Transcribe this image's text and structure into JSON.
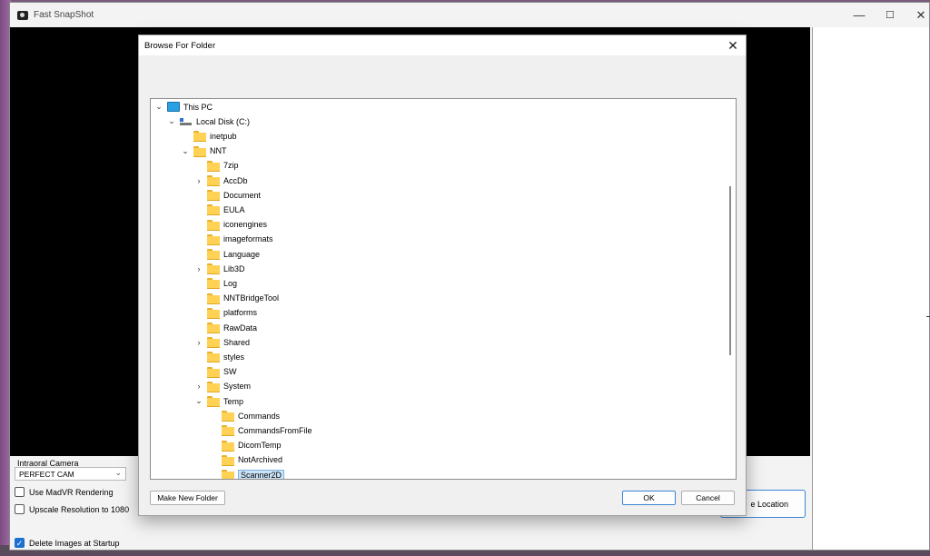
{
  "window": {
    "title": "Fast SnapShot",
    "minimize": "—",
    "maximize": "☐",
    "close": "✕"
  },
  "controls": {
    "camera_group_label": "Intraoral Camera",
    "camera_select": "PERFECT CAM",
    "use_madvr": {
      "label": "Use MadVR Rendering",
      "checked": false
    },
    "upscale": {
      "label": "Upscale Resolution to 1080",
      "checked": false
    },
    "delete_images": {
      "label": "Delete Images at Startup",
      "checked": true
    },
    "save_location_button": "e Location"
  },
  "dialog": {
    "title": "Browse For Folder",
    "close": "✕",
    "tree": [
      {
        "label": "This PC",
        "level": 0,
        "icon": "pc",
        "expander": "expanded"
      },
      {
        "label": "Local Disk (C:)",
        "level": 1,
        "icon": "drive",
        "expander": "expanded"
      },
      {
        "label": "inetpub",
        "level": 2,
        "icon": "folder",
        "expander": "none"
      },
      {
        "label": "NNT",
        "level": 2,
        "icon": "folder",
        "expander": "expanded"
      },
      {
        "label": "7zip",
        "level": 3,
        "icon": "folder",
        "expander": "none"
      },
      {
        "label": "AccDb",
        "level": 3,
        "icon": "folder",
        "expander": "collapsed"
      },
      {
        "label": "Document",
        "level": 3,
        "icon": "folder",
        "expander": "none"
      },
      {
        "label": "EULA",
        "level": 3,
        "icon": "folder",
        "expander": "none"
      },
      {
        "label": "iconengines",
        "level": 3,
        "icon": "folder",
        "expander": "none"
      },
      {
        "label": "imageformats",
        "level": 3,
        "icon": "folder",
        "expander": "none"
      },
      {
        "label": "Language",
        "level": 3,
        "icon": "folder",
        "expander": "none"
      },
      {
        "label": "Lib3D",
        "level": 3,
        "icon": "folder",
        "expander": "collapsed"
      },
      {
        "label": "Log",
        "level": 3,
        "icon": "folder",
        "expander": "none"
      },
      {
        "label": "NNTBridgeTool",
        "level": 3,
        "icon": "folder",
        "expander": "none"
      },
      {
        "label": "platforms",
        "level": 3,
        "icon": "folder",
        "expander": "none"
      },
      {
        "label": "RawData",
        "level": 3,
        "icon": "folder",
        "expander": "none"
      },
      {
        "label": "Shared",
        "level": 3,
        "icon": "folder",
        "expander": "collapsed"
      },
      {
        "label": "styles",
        "level": 3,
        "icon": "folder",
        "expander": "none"
      },
      {
        "label": "SW",
        "level": 3,
        "icon": "folder",
        "expander": "none"
      },
      {
        "label": "System",
        "level": 3,
        "icon": "folder",
        "expander": "collapsed"
      },
      {
        "label": "Temp",
        "level": 3,
        "icon": "folder",
        "expander": "expanded"
      },
      {
        "label": "Commands",
        "level": 4,
        "icon": "folder",
        "expander": "none"
      },
      {
        "label": "CommandsFromFile",
        "level": 4,
        "icon": "folder",
        "expander": "none"
      },
      {
        "label": "DicomTemp",
        "level": 4,
        "icon": "folder",
        "expander": "none"
      },
      {
        "label": "NotArchived",
        "level": 4,
        "icon": "folder",
        "expander": "none"
      },
      {
        "label": "Scanner2D",
        "level": 4,
        "icon": "folder",
        "expander": "none",
        "selected": true
      }
    ],
    "make_new_folder": "Make New Folder",
    "ok": "OK",
    "cancel": "Cancel"
  }
}
